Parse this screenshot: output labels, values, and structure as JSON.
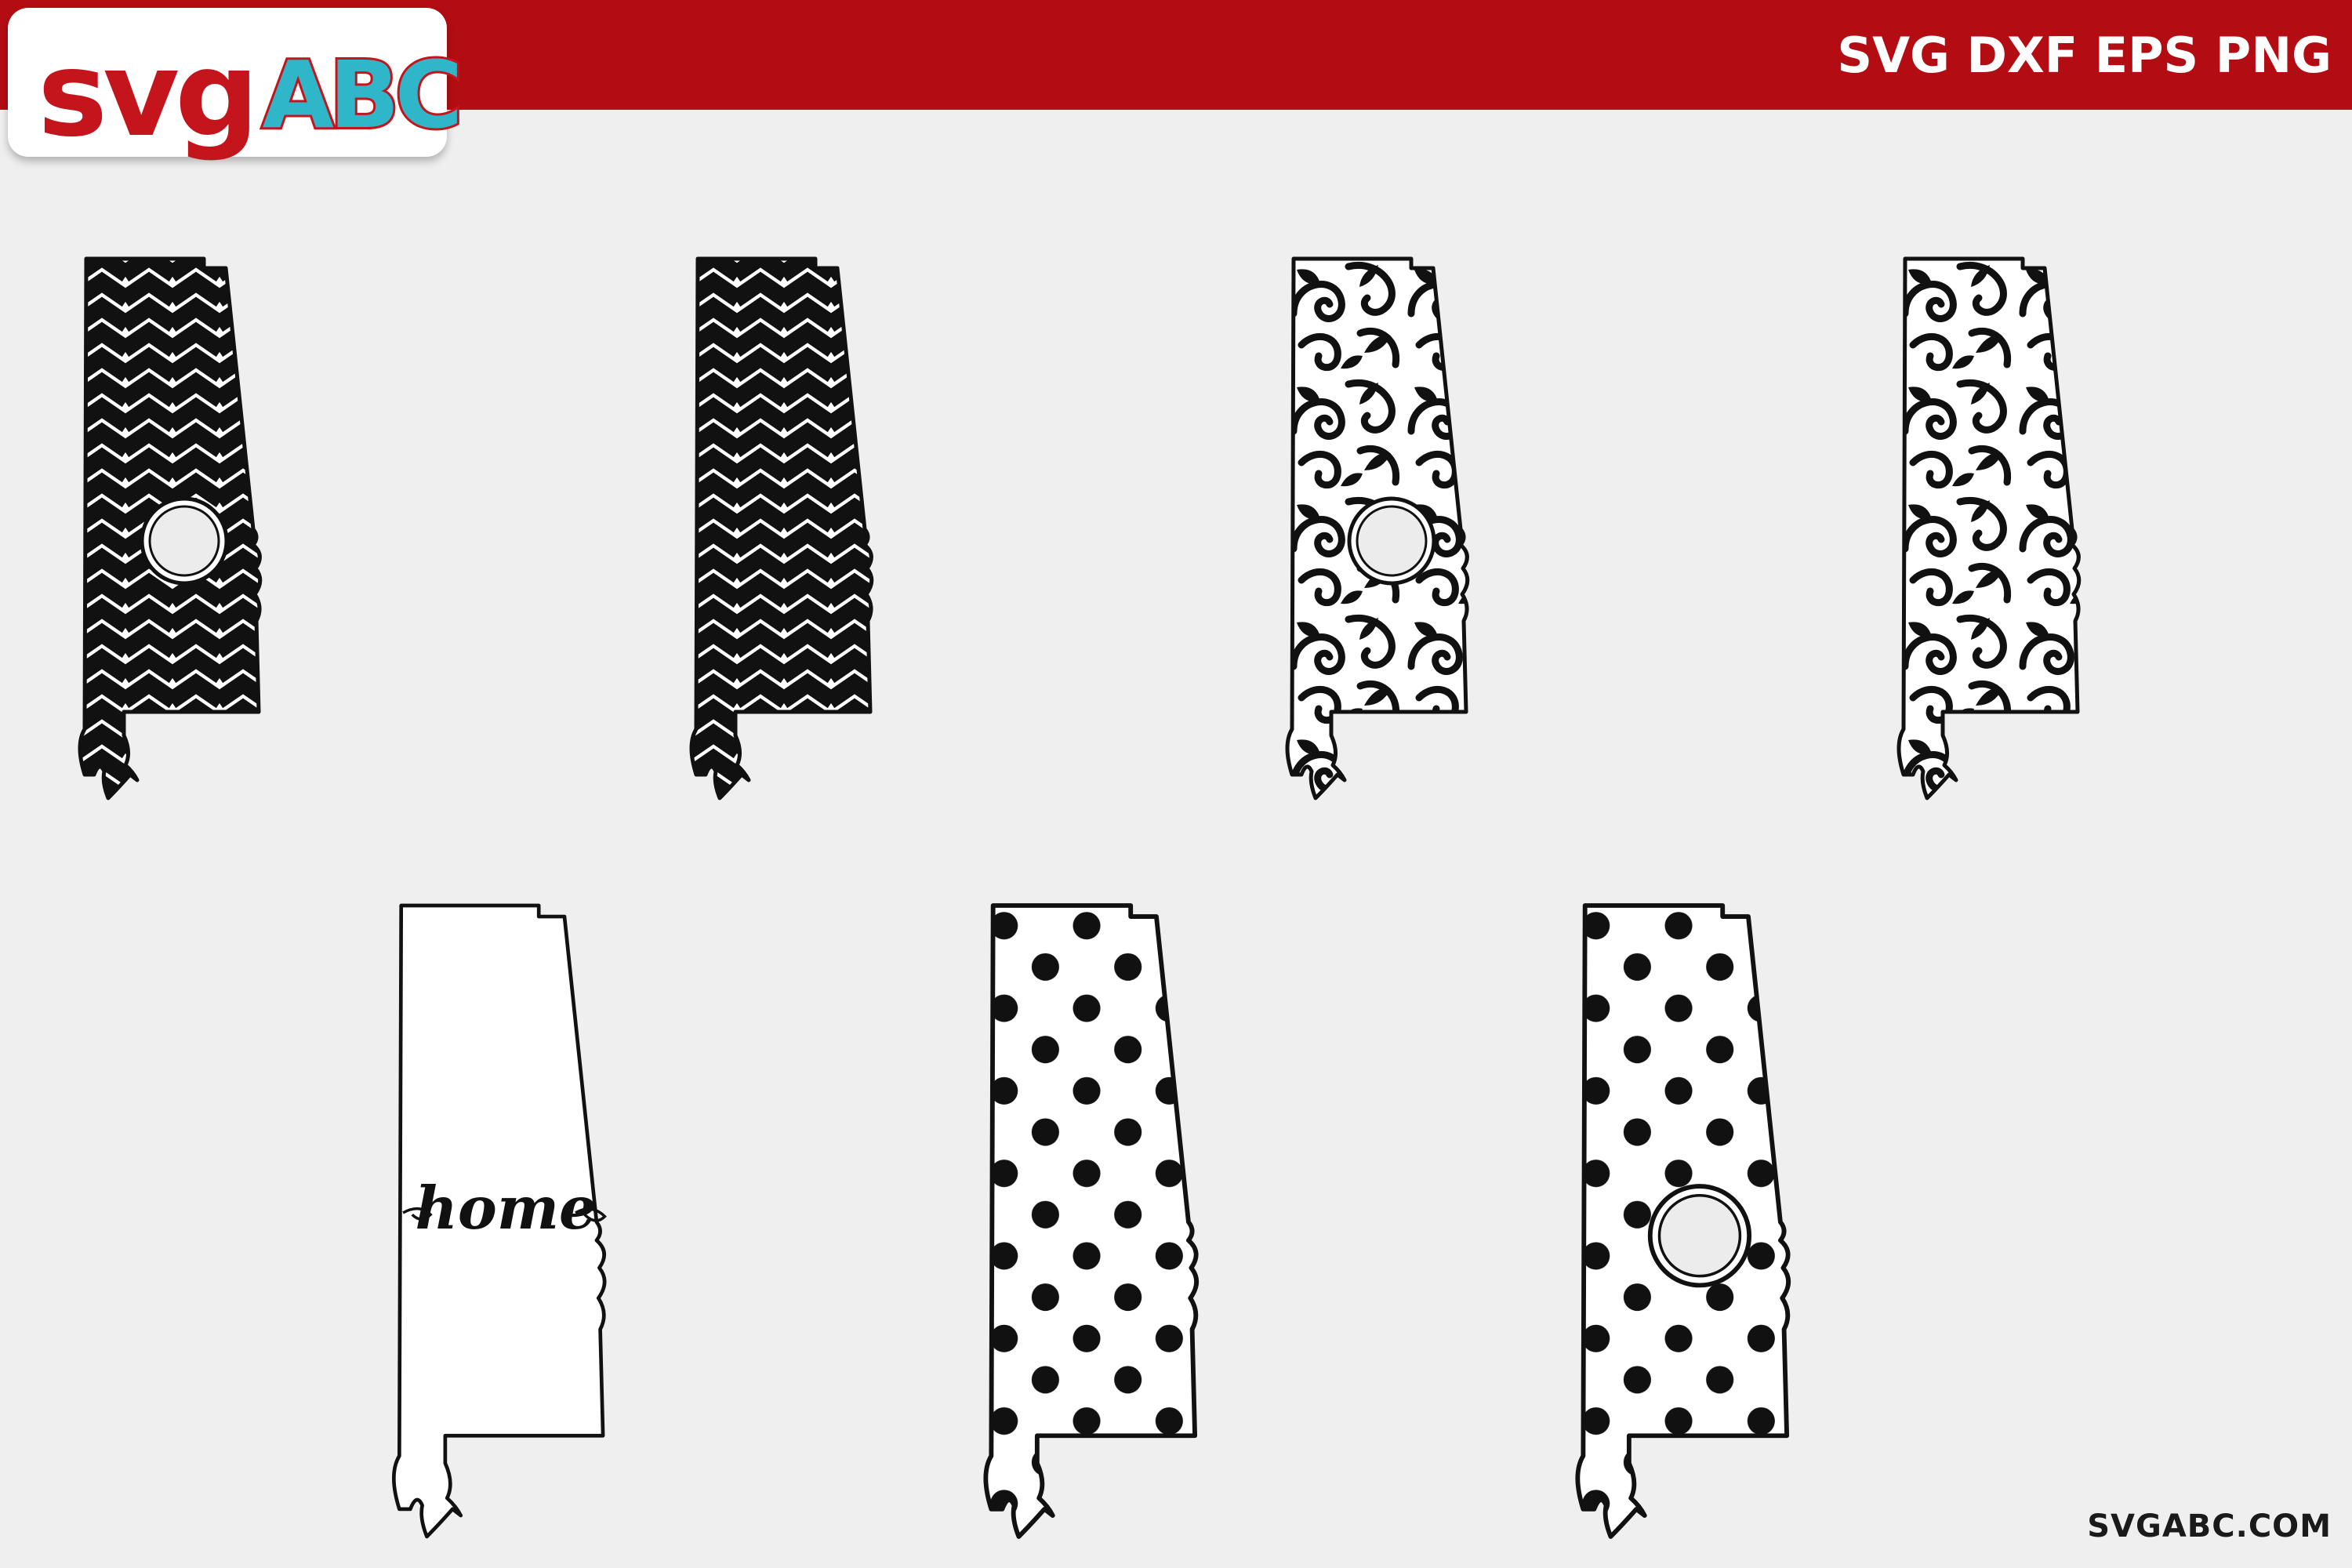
{
  "header": {
    "logo": {
      "svg_text": "svg",
      "abc_text": "ABC"
    },
    "formats_label": "SVG DXF EPS PNG",
    "banner_color": "#b30d13",
    "logo_red": "#c4151c",
    "logo_teal": "#2fb6c9"
  },
  "designs": [
    {
      "id": "chevron-monogram",
      "pattern": "chevron",
      "monogram_circle": true,
      "text": ""
    },
    {
      "id": "chevron",
      "pattern": "chevron",
      "monogram_circle": false,
      "text": ""
    },
    {
      "id": "floral-monogram",
      "pattern": "floral",
      "monogram_circle": true,
      "text": ""
    },
    {
      "id": "floral",
      "pattern": "floral",
      "monogram_circle": false,
      "text": ""
    },
    {
      "id": "home-outline",
      "pattern": "outline",
      "monogram_circle": false,
      "text": "home"
    },
    {
      "id": "polka-dot",
      "pattern": "polka-dot",
      "monogram_circle": false,
      "text": ""
    },
    {
      "id": "polka-dot-monogram",
      "pattern": "polka-dot",
      "monogram_circle": true,
      "text": ""
    }
  ],
  "footer": {
    "website": "SVGABC.COM"
  }
}
